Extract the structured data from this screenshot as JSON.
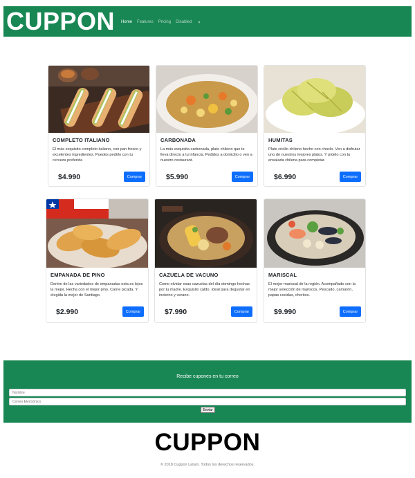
{
  "brand": "CUPPON",
  "nav": {
    "items": [
      {
        "label": "Home",
        "active": true
      },
      {
        "label": "Features",
        "active": false
      },
      {
        "label": "Pricing",
        "active": false
      },
      {
        "label": "Disabled",
        "active": false
      }
    ],
    "dropdown_icon": "caret-down-icon"
  },
  "products": [
    {
      "name": "COMPLETO ITALIANO",
      "description": "El más exquisito completo italiano, con pan fresco y excelentes ingredientes. Puedes pedirlo con tu cerveza preferida",
      "price": "$4.990",
      "button": "Comprar"
    },
    {
      "name": "CARBONADA",
      "description": "La más exquisita carbonada, plato chileno que te lleva directo a tu infancia. Pedidos a domicilio o ven a nuestro restaurant.",
      "price": "$5.990",
      "button": "Comprar"
    },
    {
      "name": "HUMITAS",
      "description": "Plato criollo chileno hecho con choclo. Ven a disfrutar uno de nuestros mejores platos. Y pídelo con tu ensalada chilena para completar.",
      "price": "$6.990",
      "button": "Comprar"
    },
    {
      "name": "EMPANADA DE PINO",
      "description": "Dentro de las variedades de empanadas esta es lejos la mejor. Hecha con el mejor pino. Carne picada. Y elegida la mejor de Santiago.",
      "price": "$2.990",
      "button": "Comprar"
    },
    {
      "name": "CAZUELA DE VACUNO",
      "description": "Como olvidar esas cazuelas del día domingo hechas por tu madre. Exquisito caldo. Ideal para degustar en invierno y verano.",
      "price": "$7.990",
      "button": "Comprar"
    },
    {
      "name": "MARISCAL",
      "description": "El mejor mariscal de la región. Acompañado con la mejor selección de mariscos. Pescado, camarón, papas cocidas, choritos.",
      "price": "$9.990",
      "button": "Comprar"
    }
  ],
  "newsletter": {
    "title": "Recibe cupones en tu correo",
    "name_placeholder": "Nombre",
    "email_placeholder": "Correo Electrónico",
    "submit": "Enviar"
  },
  "footer": {
    "logo": "CUPPON",
    "copyright": "© 2018 Cuppon Latam. Todos los derechos reservados."
  },
  "colors": {
    "brand_green": "#198754",
    "button_blue": "#0d6efd"
  }
}
